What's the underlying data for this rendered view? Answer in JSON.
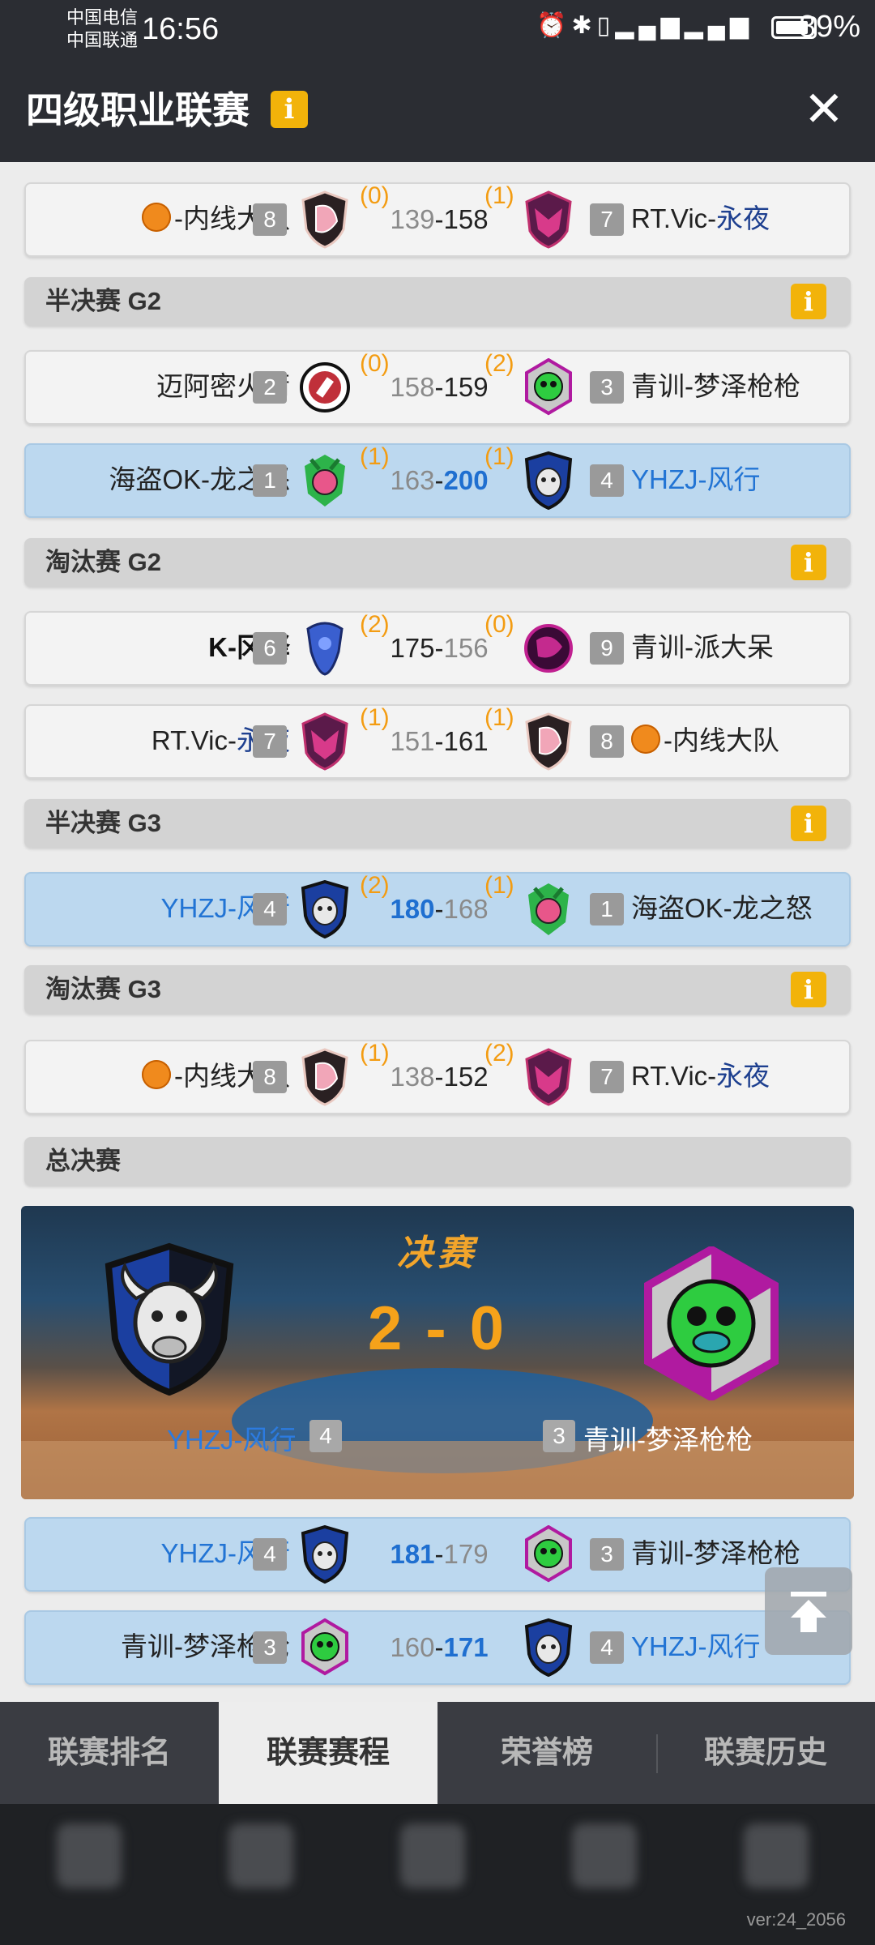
{
  "status_bar": {
    "carrier1": "中国电信",
    "carrier2": "中国联通",
    "time": "16:56",
    "battery": "89%",
    "battery_level": 0.89
  },
  "header": {
    "title": "四级职业联赛",
    "info_icon": "info-icon",
    "close_icon": "close-icon"
  },
  "matches": [
    {
      "left_team": "-内线大队",
      "left_ball": true,
      "left_rank": "8",
      "left_wins": "(0)",
      "left_score": "139",
      "right_score": "158",
      "right_wins": "(1)",
      "right_rank": "7",
      "right_team_a": "RT.Vic-",
      "right_team_b": "永夜",
      "winner": "right",
      "highlight": false
    },
    {
      "section": "半决赛 G2"
    },
    {
      "left_team": "迈阿密火箭",
      "left_rank": "2",
      "left_wins": "(0)",
      "left_score": "158",
      "right_score": "159",
      "right_wins": "(2)",
      "right_rank": "3",
      "right_team": "青训-梦泽枪枪",
      "winner": "right",
      "highlight": false
    },
    {
      "left_team": "海盗OK-龙之怒",
      "left_rank": "1",
      "left_wins": "(1)",
      "left_score": "163",
      "right_score": "200",
      "right_wins": "(1)",
      "right_rank": "4",
      "right_team": "YHZJ-风行",
      "right_blue": true,
      "winner": "right",
      "winner_bold": true,
      "highlight": true
    },
    {
      "section": "淘汰赛 G2"
    },
    {
      "left_team": "K-冈铎",
      "left_bold": true,
      "left_rank": "6",
      "left_wins": "(2)",
      "left_score": "175",
      "right_score": "156",
      "right_wins": "(0)",
      "right_rank": "9",
      "right_team": "青训-派大呆",
      "winner": "left",
      "highlight": false
    },
    {
      "left_team_a": "RT.Vic-",
      "left_team_b": "永夜",
      "left_rank": "7",
      "left_wins": "(1)",
      "left_score": "151",
      "right_score": "161",
      "right_wins": "(1)",
      "right_rank": "8",
      "right_team": "-内线大队",
      "right_ball": true,
      "winner": "right",
      "highlight": false
    },
    {
      "section": "半决赛 G3"
    },
    {
      "left_team": "YHZJ-风行",
      "left_blue": true,
      "left_rank": "4",
      "left_wins": "(2)",
      "left_score": "180",
      "right_score": "168",
      "right_wins": "(1)",
      "right_rank": "1",
      "right_team": "海盗OK-龙之怒",
      "winner": "left",
      "winner_bold": true,
      "highlight": true
    },
    {
      "section": "淘汰赛 G3"
    },
    {
      "left_team": "-内线大队",
      "left_ball": true,
      "left_rank": "8",
      "left_wins": "(1)",
      "left_score": "138",
      "right_score": "152",
      "right_wins": "(2)",
      "right_rank": "7",
      "right_team_a": "RT.Vic-",
      "right_team_b": "永夜",
      "winner": "right",
      "highlight": false
    },
    {
      "section": "总决赛",
      "no_info": true
    }
  ],
  "finals": {
    "title": "决赛",
    "score": "2 - 0",
    "left_team": "YHZJ-风行",
    "left_rank": "4",
    "right_team": "青训-梦泽枪枪",
    "right_rank": "3"
  },
  "final_games": [
    {
      "left_team": "YHZJ-风行",
      "left_blue": true,
      "left_rank": "4",
      "left_score": "181",
      "right_score": "179",
      "right_rank": "3",
      "right_team": "青训-梦泽枪枪",
      "winner": "left",
      "winner_bold": true,
      "highlight": true
    },
    {
      "left_team": "青训-梦泽枪枪",
      "left_rank": "3",
      "left_score": "160",
      "right_score": "171",
      "right_rank": "4",
      "right_team": "YHZJ-风行",
      "right_blue": true,
      "winner": "right",
      "winner_bold": true,
      "highlight": true
    }
  ],
  "tabs": [
    "联赛排名",
    "联赛赛程",
    "荣誉榜",
    "联赛历史"
  ],
  "active_tab": 1,
  "version": "ver:24_2056",
  "colors": {
    "accent": "#f2b30a",
    "win_blue": "#1f6fd0",
    "team_blue": "#2274d4",
    "wins_orange": "#f39c12"
  }
}
